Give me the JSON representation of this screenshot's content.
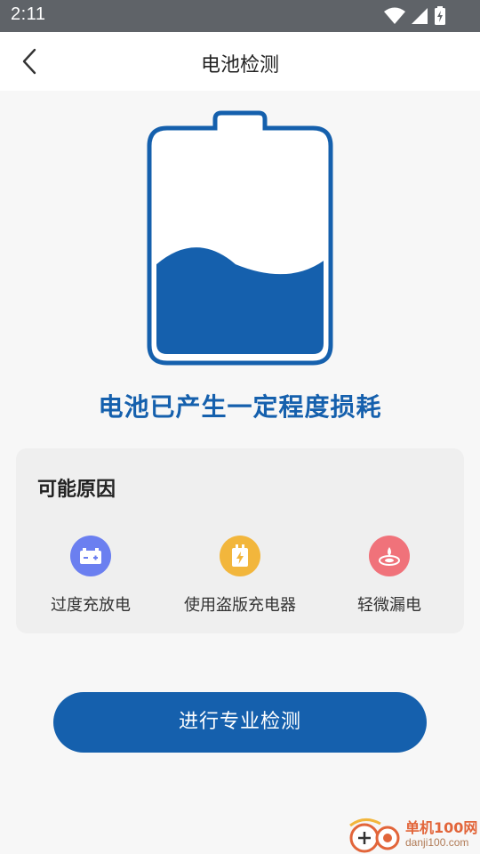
{
  "status_bar": {
    "time": "2:11"
  },
  "app_bar": {
    "title": "电池检测"
  },
  "battery": {
    "level": 0.45,
    "color": "#1560ad"
  },
  "headline": "电池已产生一定程度损耗",
  "reasons_card": {
    "title": "可能原因",
    "items": [
      {
        "label": "过度充放电",
        "icon": "battery-plus-minus-icon",
        "color": "#6b7ff0"
      },
      {
        "label": "使用盗版充电器",
        "icon": "charger-icon",
        "color": "#f2b63c"
      },
      {
        "label": "轻微漏电",
        "icon": "leak-icon",
        "color": "#f0727a"
      }
    ]
  },
  "action_button": {
    "label": "进行专业检测"
  },
  "watermark": {
    "name": "单机100网",
    "url": "danji100.com"
  }
}
